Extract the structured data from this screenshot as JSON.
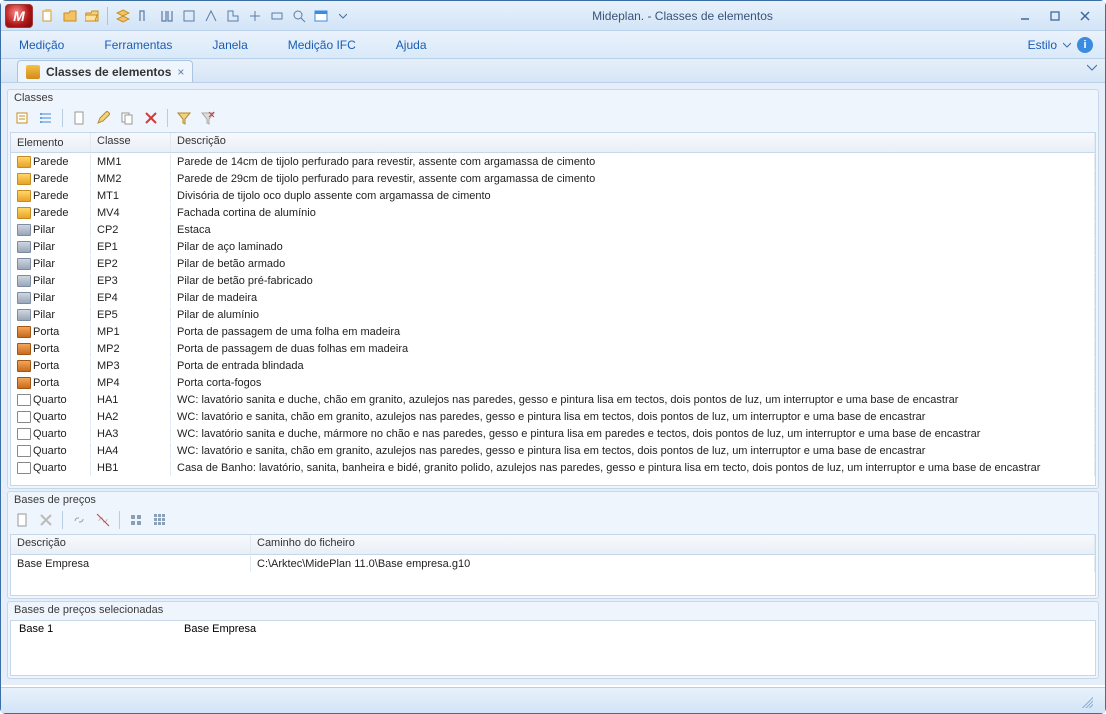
{
  "title": "Mideplan.  - Classes de elementos",
  "menu": {
    "medicao": "Medição",
    "ferramentas": "Ferramentas",
    "janela": "Janela",
    "medicao_ifc": "Medição IFC",
    "ajuda": "Ajuda",
    "estilo": "Estilo"
  },
  "tab": {
    "label": "Classes de elementos"
  },
  "classes_panel": {
    "title": "Classes",
    "columns": {
      "elemento": "Elemento",
      "classe": "Classe",
      "descricao": "Descrição"
    },
    "rows": [
      {
        "icon": "folder",
        "elemento": "Parede",
        "classe": "MM1",
        "descricao": "Parede de 14cm de tijolo perfurado para revestir, assente com argamassa de cimento"
      },
      {
        "icon": "folder",
        "elemento": "Parede",
        "classe": "MM2",
        "descricao": "Parede de 29cm de tijolo perfurado para revestir, assente com argamassa de cimento"
      },
      {
        "icon": "folder",
        "elemento": "Parede",
        "classe": "MT1",
        "descricao": "Divisória de tijolo oco duplo assente com argamassa de cimento"
      },
      {
        "icon": "folder",
        "elemento": "Parede",
        "classe": "MV4",
        "descricao": "Fachada cortina de alumínio"
      },
      {
        "icon": "pillar",
        "elemento": "Pilar",
        "classe": "CP2",
        "descricao": "Estaca"
      },
      {
        "icon": "pillar",
        "elemento": "Pilar",
        "classe": "EP1",
        "descricao": "Pilar de aço laminado"
      },
      {
        "icon": "pillar",
        "elemento": "Pilar",
        "classe": "EP2",
        "descricao": "Pilar de betão armado"
      },
      {
        "icon": "pillar",
        "elemento": "Pilar",
        "classe": "EP3",
        "descricao": "Pilar de betão pré-fabricado"
      },
      {
        "icon": "pillar",
        "elemento": "Pilar",
        "classe": "EP4",
        "descricao": "Pilar de madeira"
      },
      {
        "icon": "pillar",
        "elemento": "Pilar",
        "classe": "EP5",
        "descricao": "Pilar de alumínio"
      },
      {
        "icon": "door",
        "elemento": "Porta",
        "classe": "MP1",
        "descricao": "Porta de passagem de uma folha em madeira"
      },
      {
        "icon": "door",
        "elemento": "Porta",
        "classe": "MP2",
        "descricao": "Porta de passagem de duas folhas em madeira"
      },
      {
        "icon": "door",
        "elemento": "Porta",
        "classe": "MP3",
        "descricao": "Porta de entrada blindada"
      },
      {
        "icon": "door",
        "elemento": "Porta",
        "classe": "MP4",
        "descricao": "Porta corta-fogos"
      },
      {
        "icon": "room",
        "elemento": "Quarto",
        "classe": "HA1",
        "descricao": "WC: lavatório sanita e duche, chão em granito, azulejos nas paredes, gesso e pintura lisa em tectos, dois pontos de luz, um interruptor e uma base de encastrar"
      },
      {
        "icon": "room",
        "elemento": "Quarto",
        "classe": "HA2",
        "descricao": "WC: lavatório e sanita, chão em granito, azulejos nas paredes, gesso e pintura lisa em tectos, dois pontos de luz, um interruptor e uma base de encastrar"
      },
      {
        "icon": "room",
        "elemento": "Quarto",
        "classe": "HA3",
        "descricao": "WC: lavatório sanita e duche, mármore no chão e nas paredes, gesso e pintura lisa em paredes e tectos, dois pontos de luz, um interruptor e uma base de encastrar"
      },
      {
        "icon": "room",
        "elemento": "Quarto",
        "classe": "HA4",
        "descricao": "WC: lavatório e sanita, chão em granito, azulejos nas paredes, gesso e pintura lisa em tectos, dois pontos de luz, um interruptor e uma base de encastrar"
      },
      {
        "icon": "room",
        "elemento": "Quarto",
        "classe": "HB1",
        "descricao": "Casa de Banho: lavatório, sanita, banheira e bidé, granito polido, azulejos nas paredes, gesso e pintura lisa em tecto, dois pontos de luz, um interruptor e uma base de encastrar"
      }
    ]
  },
  "bases_panel": {
    "title": "Bases de preços",
    "columns": {
      "descricao": "Descrição",
      "caminho": "Caminho do ficheiro"
    },
    "rows": [
      {
        "descricao": "Base Empresa",
        "caminho": "C:\\Arktec\\MidePlan 11.0\\Base empresa.g10"
      }
    ]
  },
  "selected_panel": {
    "title": "Bases de preços selecionadas",
    "rows": [
      {
        "name": "Base 1",
        "value": "Base Empresa"
      }
    ]
  }
}
